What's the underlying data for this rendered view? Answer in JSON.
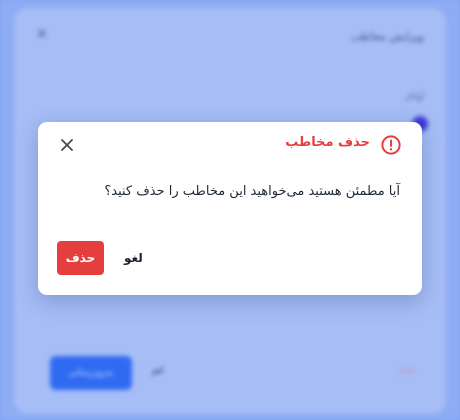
{
  "background_sheet": {
    "title": "ویرایش مخاطب",
    "close_glyph": "×",
    "field_label": "آواتار",
    "save_label": "به‌روزرسانی",
    "cancel_label": "لغو",
    "delete_label": "حذف"
  },
  "dialog": {
    "title": "حذف مخاطب",
    "message": "آیا مطمئن هستید می‌خواهید این مخاطب را حذف کنید؟",
    "delete_label": "حذف",
    "cancel_label": "لغو",
    "icons": {
      "warning": "warning-circle-icon",
      "close": "close-icon"
    },
    "colors": {
      "danger": "#e53e3e",
      "text": "#1f2937",
      "overlay": "#7fa2f4"
    }
  }
}
